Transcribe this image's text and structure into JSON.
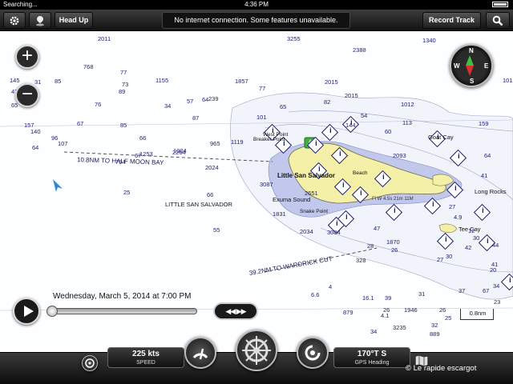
{
  "status_bar": {
    "carrier": "Searching...",
    "time": "4:36 PM"
  },
  "toolbar": {
    "settings_icon": "gear-icon",
    "marker_icon": "pin-icon",
    "head_up_label": "Head Up",
    "banner": "No internet connection. Some features unavailable.",
    "record_label": "Record Track",
    "search_icon": "search-icon"
  },
  "zoom": {
    "in": "+",
    "out": "−"
  },
  "compass": {
    "n": "N",
    "s": "S",
    "e": "E",
    "w": "W"
  },
  "chart": {
    "routes": [
      "10.8NM TO HALF MOON BAY",
      "39.2NM TO WARDRICK CUT"
    ],
    "place_names": [
      "LITTLE SAN SALVADOR",
      "Little San Salvador",
      "Exuma Sound",
      "Goat Cay",
      "Long Rocks",
      "Tee Cay",
      "West Point",
      "Breaker Point",
      "Beach",
      "Snake Point"
    ],
    "light_label": "Fl W 4.5s 21m 11M",
    "scale": "0.8nm",
    "depths": [
      "2011",
      "3255",
      "2388",
      "1340",
      "768",
      "77",
      "1155",
      "1857",
      "2015",
      "101",
      "145",
      "31",
      "85",
      "89",
      "73",
      "77",
      "239",
      "1012",
      "2015",
      "47",
      "65",
      "76",
      "64",
      "34",
      "65",
      "82",
      "57",
      "157",
      "67",
      "85",
      "66",
      "87",
      "101",
      "54",
      "113",
      "159",
      "140",
      "96",
      "107",
      "794",
      "1253",
      "1004",
      "965",
      "1119",
      "144",
      "60",
      "64",
      "64",
      "67",
      "2264",
      "2024",
      "2093",
      "41",
      "25",
      "66",
      "3087",
      "2651",
      "1831",
      "55",
      "2034",
      "3084",
      "1870",
      "328",
      "26",
      "30",
      "28",
      "27",
      "30",
      "47",
      "42",
      "34",
      "41",
      "20",
      "12",
      "44",
      "4",
      "6.6",
      "16.1",
      "39",
      "26",
      "1946",
      "23",
      "26",
      "31",
      "25",
      "32",
      "37",
      "67",
      "879",
      "889",
      "4.1",
      "34",
      "3235",
      "4.9",
      "27",
      "2625",
      "111",
      "50",
      "8.2",
      "6.2"
    ]
  },
  "playback": {
    "date": "Wednesday, March 5, 2014 at 7:00 PM",
    "progress": 0.0,
    "skip_label": "◀◀ ▶▶"
  },
  "bottom": {
    "speed_value": "225 kts",
    "speed_label": "SPEED",
    "heading_value": "170°T S",
    "heading_label": "GPS Heading",
    "watermark": "© Le rapide escargot",
    "colors": {
      "land": "#f5f0a8",
      "shallow": "#c2c8ec",
      "route": "#444444",
      "boat": "#2a8ad8"
    }
  }
}
